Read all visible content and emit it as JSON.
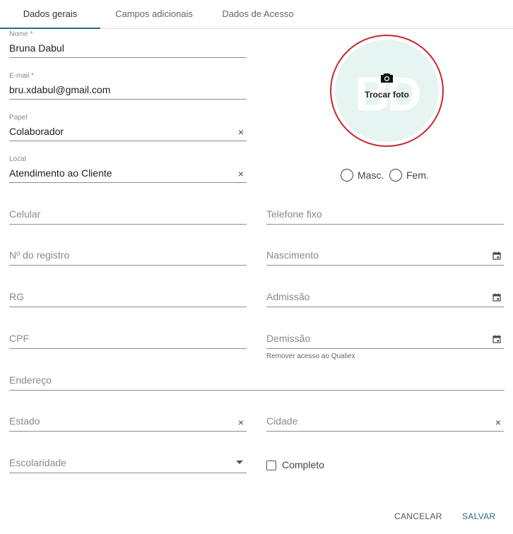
{
  "tabs": [
    {
      "label": "Dados gerais"
    },
    {
      "label": "Campos adicionais"
    },
    {
      "label": "Dados de Acesso"
    }
  ],
  "form": {
    "nome": {
      "label": "Nome *",
      "value": "Bruna Dabul"
    },
    "email": {
      "label": "E-mail *",
      "value": "bru.xdabul@gmail.com"
    },
    "papel": {
      "label": "Papel",
      "value": "Colaborador",
      "clear": "×"
    },
    "local": {
      "label": "Local",
      "value": "Atendimento ao Cliente",
      "clear": "×"
    },
    "celular": {
      "placeholder": "Celular"
    },
    "telefone": {
      "placeholder": "Telefone fixo"
    },
    "registro": {
      "placeholder": "Nº do registro"
    },
    "nascimento": {
      "placeholder": "Nascimento"
    },
    "rg": {
      "placeholder": "RG"
    },
    "admissao": {
      "placeholder": "Admissão"
    },
    "cpf": {
      "placeholder": "CPF"
    },
    "demissao": {
      "placeholder": "Demissão",
      "hint": "Remover acesso ao Qualiex"
    },
    "endereco": {
      "placeholder": "Endereço"
    },
    "estado": {
      "placeholder": "Estado",
      "clear": "×"
    },
    "cidade": {
      "placeholder": "Cidade",
      "clear": "×"
    },
    "escolaridade": {
      "placeholder": "Escolaridade"
    },
    "completo": {
      "label": "Completo",
      "checked": false
    }
  },
  "avatar": {
    "initials": "BD",
    "change_label": "Trocar foto",
    "bg_color": "#e6f5f2",
    "ring_color": "#c62830"
  },
  "gender": {
    "masc": "Masc.",
    "fem": "Fem."
  },
  "actions": {
    "cancel": "CANCELAR",
    "save": "SALVAR"
  },
  "colors": {
    "accent": "#2a6b8c"
  }
}
